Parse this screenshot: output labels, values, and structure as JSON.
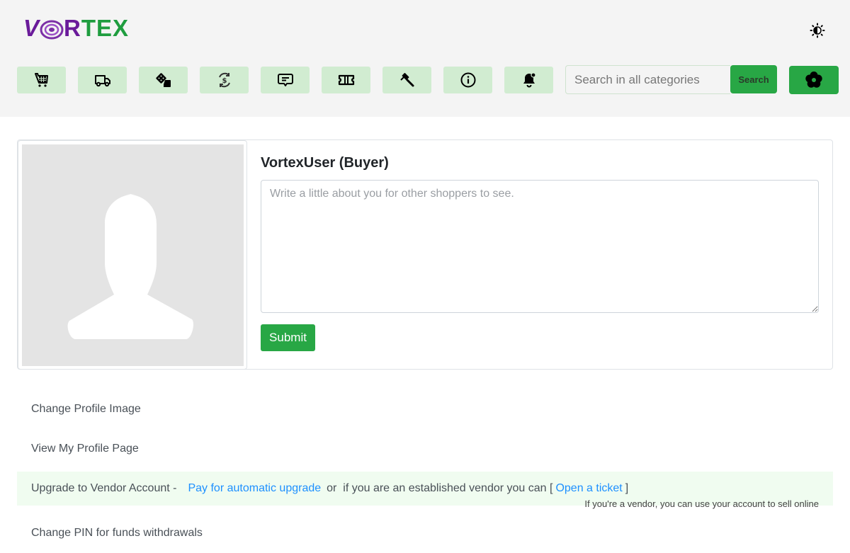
{
  "header": {
    "logo": {
      "part_v": "V",
      "part_r": "R",
      "part_tex": "TEX",
      "alt": "VORTEX"
    },
    "theme_toggle_icon": "contrast-sun-icon",
    "nav_items": [
      {
        "name": "cart",
        "icon": "shopping-cart-icon"
      },
      {
        "name": "orders",
        "icon": "truck-icon"
      },
      {
        "name": "games",
        "icon": "dice-icon"
      },
      {
        "name": "exchange",
        "icon": "currency-exchange-icon"
      },
      {
        "name": "messages",
        "icon": "message-icon"
      },
      {
        "name": "tickets",
        "icon": "ticket-icon"
      },
      {
        "name": "disputes",
        "icon": "gavel-icon"
      },
      {
        "name": "info",
        "icon": "info-icon"
      },
      {
        "name": "notifications",
        "icon": "bell-icon"
      }
    ],
    "search": {
      "placeholder": "Search in all categories",
      "value": "",
      "button_label": "Search"
    },
    "settings_icon": "flower-gear-icon"
  },
  "profile": {
    "username": "VortexUser (Buyer)",
    "bio_placeholder": "Write a little about you for other shoppers to see.",
    "bio_value": "",
    "submit_label": "Submit"
  },
  "links": {
    "change_image": "Change Profile Image",
    "view_profile": "View My Profile Page",
    "upgrade": {
      "prefix": "Upgrade to Vendor Account -",
      "pay_link": "Pay for automatic upgrade",
      "middle": "or  if you are an established vendor you can [",
      "ticket_link": "Open a ticket",
      "suffix": "]",
      "note": "If you're a vendor, you can use your account to sell online"
    },
    "change_pin": "Change PIN for funds withdrawals"
  },
  "colors": {
    "accent_green": "#28a745",
    "nav_bg": "#d1ecd1",
    "link_blue": "#1e90ff",
    "logo_purple": "#6a1b9a",
    "logo_green": "#1f9d3f"
  }
}
